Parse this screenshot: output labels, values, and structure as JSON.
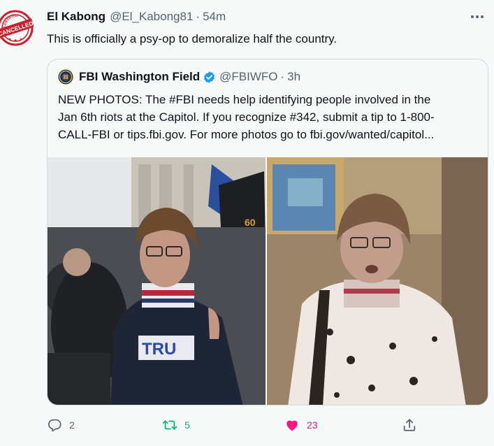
{
  "tweet": {
    "author_name": "El Kabong",
    "author_handle": "@El_Kabong81",
    "separator": "·",
    "time": "54m",
    "text": "This is officially a psy-op to demoralize half the country."
  },
  "avatar": {
    "stamp_text": "CANCELLED",
    "ring_text": "CERTIFIED",
    "color": "#c8202c"
  },
  "quote": {
    "author_name": "FBI Washington Field",
    "author_handle": "@FBIWFO",
    "separator": "·",
    "time": "3h",
    "verified_color": "#1d9bf0",
    "text_lines": [
      "NEW PHOTOS: The #FBI needs help identifying people involved in the",
      "Jan 6th riots at the Capitol. If you recognize #342, submit a tip to 1-800-",
      "CALL-FBI or tips.fbi.gov. For more photos go to fbi.gov/wanted/capitol..."
    ],
    "photo_overlay_text": "TRU"
  },
  "actions": {
    "reply_count": "2",
    "retweet_count": "5",
    "like_count": "23",
    "reply_icon": "reply-icon",
    "retweet_icon": "retweet-icon",
    "like_icon": "heart-icon",
    "share_icon": "share-icon",
    "retweet_color": "#00ba7c",
    "like_color": "#f91880"
  }
}
